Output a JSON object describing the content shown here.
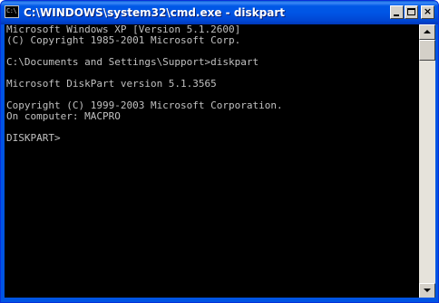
{
  "window": {
    "title": "C:\\WINDOWS\\system32\\cmd.exe - diskpart",
    "icon_label": "C:\\"
  },
  "titlebar_buttons": {
    "minimize": "minimize",
    "maximize": "maximize",
    "close": "×"
  },
  "console": {
    "lines": [
      "Microsoft Windows XP [Version 5.1.2600]",
      "(C) Copyright 1985-2001 Microsoft Corp.",
      "",
      "C:\\Documents and Settings\\Support>diskpart",
      "",
      "Microsoft DiskPart version 5.1.3565",
      "",
      "Copyright (C) 1999-2003 Microsoft Corporation.",
      "On computer: MACPRO",
      "",
      "DISKPART>"
    ]
  },
  "colors": {
    "titlebar": "#0054e3",
    "console_bg": "#000000",
    "console_text": "#c0c0c0"
  }
}
